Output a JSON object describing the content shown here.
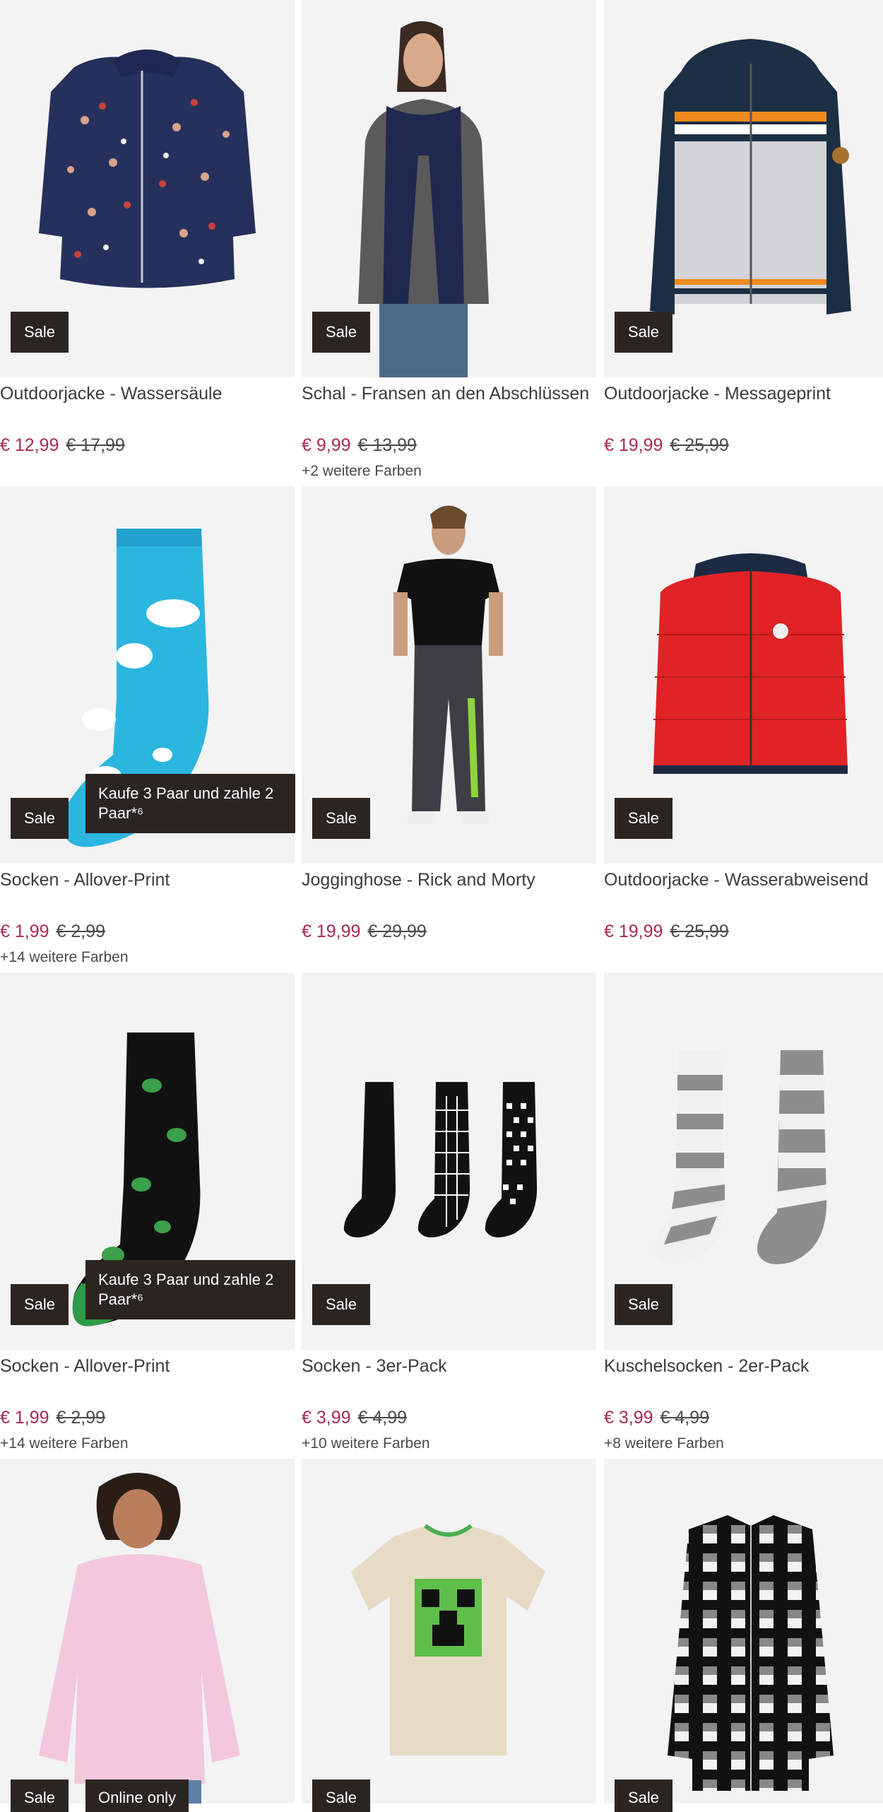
{
  "products": [
    {
      "title": "Outdoorjacke - Wassersäule",
      "price": "€ 12,99",
      "old_price": "€ 17,99",
      "badge": "Sale",
      "promo": "",
      "colors": ""
    },
    {
      "title": "Schal - Fransen an den Abschlüssen",
      "price": "€ 9,99",
      "old_price": "€ 13,99",
      "badge": "Sale",
      "promo": "",
      "colors": "+2 weitere Farben"
    },
    {
      "title": "Outdoorjacke - Messageprint",
      "price": "€ 19,99",
      "old_price": "€ 25,99",
      "badge": "Sale",
      "promo": "",
      "colors": ""
    },
    {
      "title": "Socken - Allover-Print",
      "price": "€ 1,99",
      "old_price": "€ 2,99",
      "badge": "Sale",
      "promo": "Kaufe 3 Paar und zahle 2 Paar*⁶",
      "colors": "+14 weitere Farben"
    },
    {
      "title": "Jogginghose - Rick and Morty",
      "price": "€ 19,99",
      "old_price": "€ 29,99",
      "badge": "Sale",
      "promo": "",
      "colors": ""
    },
    {
      "title": "Outdoorjacke - Wasserabweisend",
      "price": "€ 19,99",
      "old_price": "€ 25,99",
      "badge": "Sale",
      "promo": "",
      "colors": ""
    },
    {
      "title": "Socken - Allover-Print",
      "price": "€ 1,99",
      "old_price": "€ 2,99",
      "badge": "Sale",
      "promo": "Kaufe 3 Paar und zahle 2 Paar*⁶",
      "colors": "+14 weitere Farben"
    },
    {
      "title": "Socken - 3er-Pack",
      "price": "€ 3,99",
      "old_price": "€ 4,99",
      "badge": "Sale",
      "promo": "",
      "colors": "+10 weitere Farben"
    },
    {
      "title": "Kuschelsocken - 2er-Pack",
      "price": "€ 3,99",
      "old_price": "€ 4,99",
      "badge": "Sale",
      "promo": "",
      "colors": "+8 weitere Farben"
    },
    {
      "title": "",
      "price": "",
      "old_price": "",
      "badge": "Sale",
      "promo": "Online only",
      "colors": ""
    },
    {
      "title": "",
      "price": "",
      "old_price": "",
      "badge": "Sale",
      "promo": "",
      "colors": ""
    },
    {
      "title": "",
      "price": "",
      "old_price": "",
      "badge": "Sale",
      "promo": "",
      "colors": ""
    }
  ],
  "images": [
    "navy-floral-jacket",
    "model-navy-scarf",
    "colorblock-hooded-jacket",
    "cloud-print-sock",
    "model-jogging-pants",
    "red-puffer-jacket",
    "frog-print-sock",
    "three-pack-socks",
    "fuzzy-striped-socks",
    "model-pink-sweater",
    "minecraft-tshirt",
    "plaid-shirt"
  ]
}
